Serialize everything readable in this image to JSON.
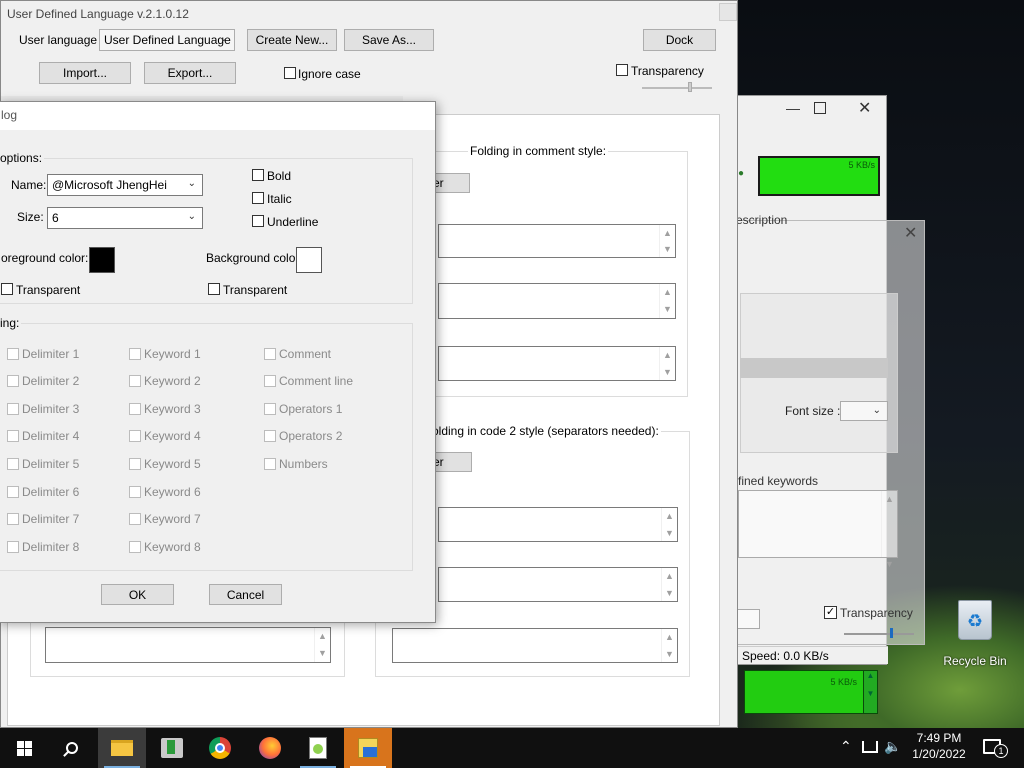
{
  "main_window": {
    "title": "User Defined Language v.2.1.0.12",
    "user_language_label": "User language :",
    "user_language_value": "User Defined Language",
    "create_new": "Create New...",
    "save_as": "Save As...",
    "dock": "Dock",
    "import": "Import...",
    "export": "Export...",
    "ignore_case": "Ignore case",
    "transparency": "Transparency",
    "folding_comment_style": "Folding in comment style:",
    "folding_code2_style": "olding in code 2 style (separators needed):",
    "partial_btn_1": "er",
    "partial_btn_2": "er"
  },
  "dialog": {
    "title": "log",
    "font_options_label": "options:",
    "name_label": "Name:",
    "name_value": "@Microsoft JhengHei",
    "size_label": "Size:",
    "size_value": "6",
    "bold": "Bold",
    "italic": "Italic",
    "underline": "Underline",
    "foreground_label": "oreground color:",
    "background_label": "Background color:",
    "transparent_1": "Transparent",
    "transparent_2": "Transparent",
    "nesting_label": "ing:",
    "col1": [
      "Delimiter 1",
      "Delimiter 2",
      "Delimiter 3",
      "Delimiter 4",
      "Delimiter 5",
      "Delimiter 6",
      "Delimiter 7",
      "Delimiter 8"
    ],
    "col2": [
      "Keyword 1",
      "Keyword 2",
      "Keyword 3",
      "Keyword 4",
      "Keyword 5",
      "Keyword 6",
      "Keyword 7",
      "Keyword 8"
    ],
    "col3": [
      "Comment",
      "Comment line",
      "Operators 1",
      "Operators 2",
      "Numbers"
    ],
    "ok": "OK",
    "cancel": "Cancel",
    "colors": {
      "foreground": "#000000",
      "background": "#ffffff"
    }
  },
  "speed_window": {
    "speed_badge": "5 KB/s",
    "description_partial": "escription",
    "font_size_label": "Font size :",
    "defined_keywords": "fined keywords",
    "transparency": "Transparency",
    "speed_text": "Speed: 0.0 KB/s",
    "mini_badge": "5 KB/s"
  },
  "desktop": {
    "recycle_bin": "Recycle Bin"
  },
  "taskbar": {
    "time": "7:49 PM",
    "date": "1/20/2022",
    "notification_count": "1"
  }
}
